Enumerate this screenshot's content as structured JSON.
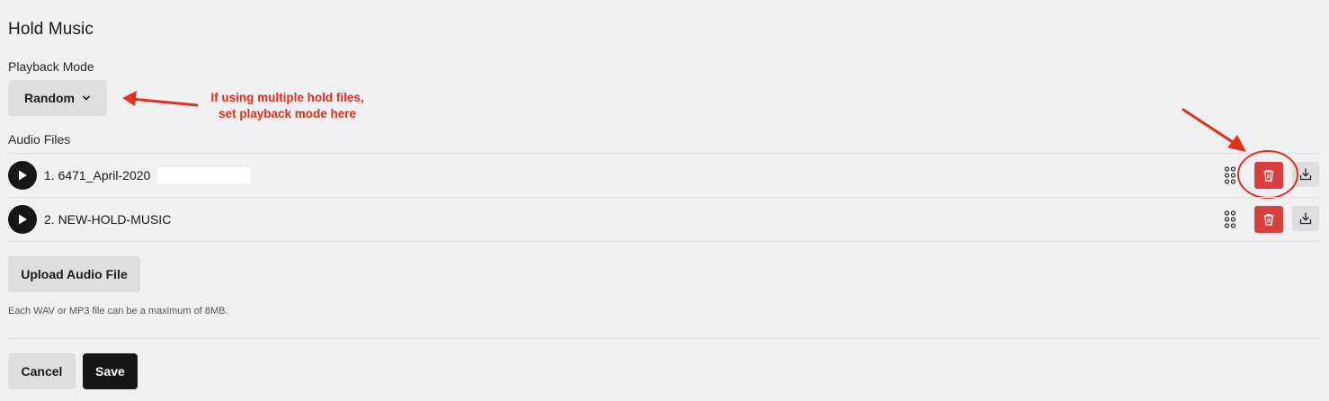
{
  "page": {
    "title": "Hold Music"
  },
  "playback": {
    "label": "Playback Mode",
    "selected": "Random"
  },
  "audio": {
    "label": "Audio Files",
    "files": [
      {
        "name": "1. 6471_April-2020"
      },
      {
        "name": "2. NEW-HOLD-MUSIC"
      }
    ]
  },
  "upload": {
    "button_label": "Upload Audio File",
    "hint": "Each WAV or MP3 file can be a maximum of 8MB."
  },
  "footer": {
    "cancel_label": "Cancel",
    "save_label": "Save"
  },
  "annotation": {
    "line1": "If using multiple hold files,",
    "line2": "set playback mode here",
    "color": "#e0301e"
  },
  "colors": {
    "background": "#f0f0f2",
    "delete": "#d64040",
    "primary_button": "#161616",
    "secondary_button": "#dedee1"
  }
}
